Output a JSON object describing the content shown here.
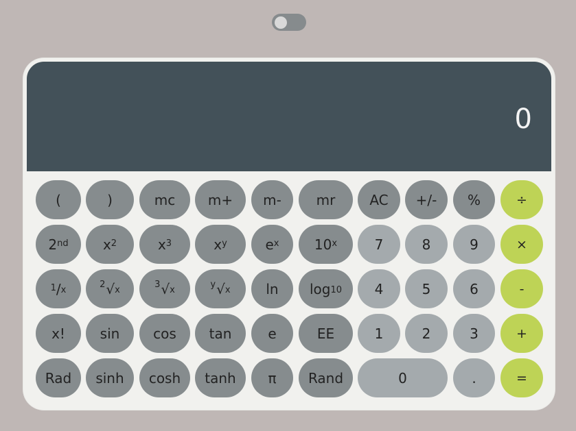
{
  "toggle": {
    "state": "off"
  },
  "display": {
    "value": "0"
  },
  "colors": {
    "background": "#bfb7b5",
    "display": "#435159",
    "function_key": "#868c8e",
    "number_key": "#a4aaad",
    "operator_key": "#bed356",
    "panel": "#f1f1ee"
  },
  "keys": {
    "open_paren": "(",
    "close_paren": ")",
    "mc": "mc",
    "m_plus": "m+",
    "m_minus": "m-",
    "mr": "mr",
    "ac": "AC",
    "plus_minus": "+/-",
    "percent": "%",
    "divide": "÷",
    "second_base": "2",
    "second_sup": "nd",
    "x_squared_base": "x",
    "x_squared_sup": "2",
    "x_cubed_base": "x",
    "x_cubed_sup": "3",
    "x_pow_y_base": "x",
    "x_pow_y_sup": "y",
    "e_pow_x_base": "e",
    "e_pow_x_sup": "x",
    "ten_pow_x_base": "10",
    "ten_pow_x_sup": "x",
    "seven": "7",
    "eight": "8",
    "nine": "9",
    "multiply": "×",
    "reciprocal_num": "1",
    "reciprocal_sep": "/",
    "reciprocal_den": "x",
    "sqrt_index": "2",
    "sqrt_sign": "√",
    "sqrt_sub": "x",
    "cbrt_index": "3",
    "cbrt_sign": "√",
    "cbrt_sub": "x",
    "yroot_index": "y",
    "yroot_sign": "√",
    "yroot_sub": "x",
    "ln": "ln",
    "log_base": "log",
    "log_sub": "10",
    "four": "4",
    "five": "5",
    "six": "6",
    "minus": "-",
    "factorial": "x!",
    "sin": "sin",
    "cos": "cos",
    "tan": "tan",
    "e": "e",
    "ee": "EE",
    "one": "1",
    "two": "2",
    "three": "3",
    "plus": "+",
    "rad": "Rad",
    "sinh": "sinh",
    "cosh": "cosh",
    "tanh": "tanh",
    "pi": "π",
    "rand": "Rand",
    "zero": "0",
    "decimal": ".",
    "equals": "="
  }
}
